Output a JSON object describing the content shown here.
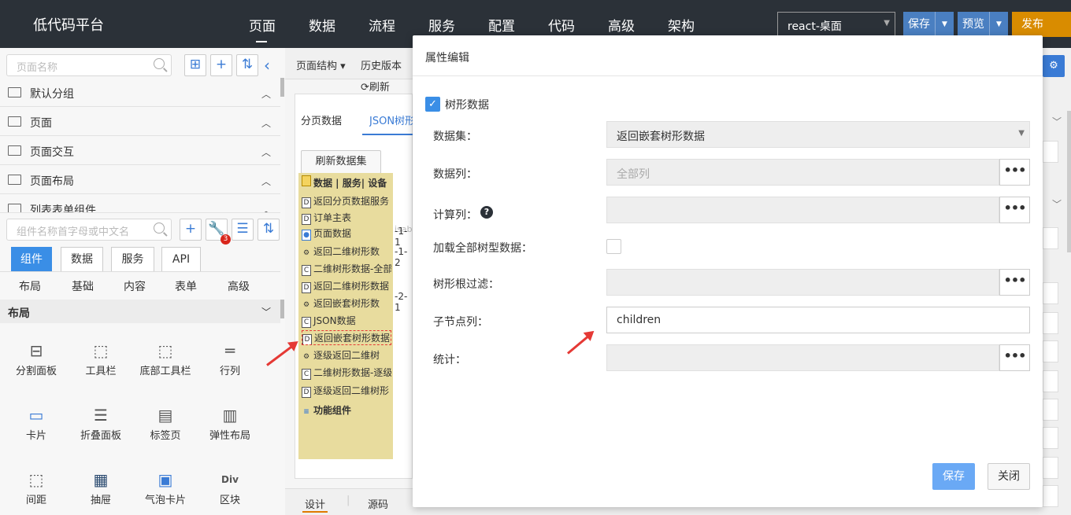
{
  "app": {
    "title": "低代码平台"
  },
  "nav": [
    "页面",
    "数据",
    "流程",
    "服务",
    "配置",
    "代码",
    "高级",
    "架构"
  ],
  "header": {
    "env": "react-桌面",
    "save": "保存",
    "preview": "预览",
    "publish": "发布"
  },
  "colors": {
    "topbar": "#2b3138",
    "primary": "#3a8ee6",
    "publish": "#d98c00",
    "annotation_red": "#e53935"
  },
  "left": {
    "page_search_placeholder": "页面名称",
    "groups": [
      "默认分组",
      "页面",
      "页面交互",
      "页面布局",
      "列表表单组件"
    ],
    "comp_search_placeholder": "组件名称首字母或中文名",
    "badge": "3",
    "tabs": [
      "组件",
      "数据",
      "服务",
      "API"
    ],
    "subtabs": [
      "布局",
      "基础",
      "内容",
      "表单",
      "高级"
    ],
    "section": "布局",
    "components": [
      "分割面板",
      "工具栏",
      "底部工具栏",
      "行列",
      "卡片",
      "折叠面板",
      "标签页",
      "弹性布局",
      "间距",
      "抽屉",
      "气泡卡片",
      "区块"
    ]
  },
  "middle": {
    "toolbar": [
      "页面结构",
      "历史版本"
    ],
    "refresh": "刷新",
    "tabs": [
      "分页数据",
      "JSON树形"
    ],
    "refresh_dataset": "刷新数据集",
    "tree_root": "数据 | 服务| 设备",
    "tree_items": [
      "返回分页数据服务",
      "订单主表",
      "页面数据",
      "返回二维树形数",
      "二维树形数据-全部",
      "返回二维树形数据",
      "返回嵌套树形数",
      "JSON数据",
      "返回嵌套树形数据",
      "逐级返回二维树",
      "二维树形数据-逐级",
      "逐级返回二维树形"
    ],
    "tree_func": "功能组件",
    "bottom_tabs": [
      "设计",
      "源码"
    ],
    "bg_fragments": [
      "isab",
      "-1-1",
      "-1-2",
      "-2-1"
    ]
  },
  "modal": {
    "title": "属性编辑",
    "tree_data_label": "树形数据",
    "fields": {
      "dataset": {
        "label": "数据集：",
        "value": "返回嵌套树形数据"
      },
      "datacol": {
        "label": "数据列：",
        "placeholder": "全部列"
      },
      "calccol": {
        "label": "计算列："
      },
      "loadall": {
        "label": "加载全部树型数据："
      },
      "rootfilter": {
        "label": "树形根过滤："
      },
      "childcol": {
        "label": "子节点列：",
        "value": "children"
      },
      "stats": {
        "label": "统计："
      }
    },
    "save": "保存",
    "close": "关闭"
  }
}
